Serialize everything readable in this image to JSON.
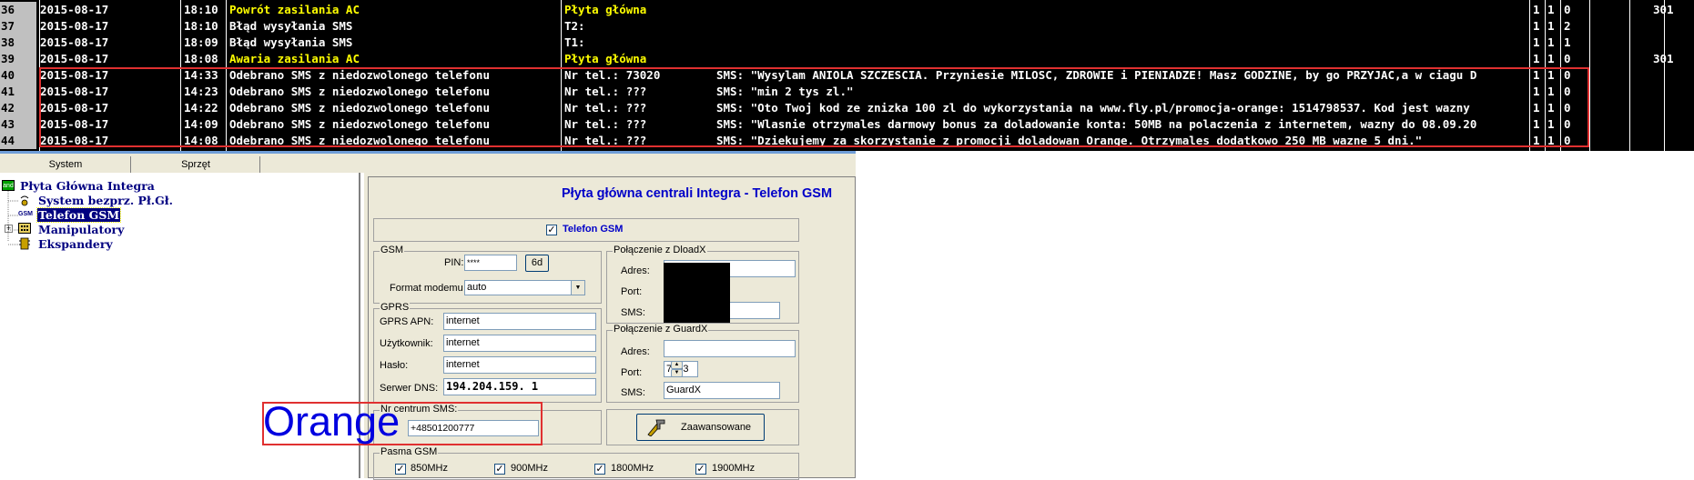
{
  "log": {
    "rows": [
      {
        "num": "36",
        "date": "2015-08-17",
        "time": "18:10",
        "desc": "Powrót zasilania AC",
        "src": "Płyta główna",
        "extra": "",
        "f1": "1",
        "f2": "1",
        "f3": "0",
        "f4": "301",
        "yellow": true
      },
      {
        "num": "37",
        "date": "2015-08-17",
        "time": "18:10",
        "desc": "Błąd wysyłania SMS",
        "src": "T2:",
        "extra": "",
        "f1": "1",
        "f2": "1",
        "f3": "2",
        "f4": "",
        "yellow": false
      },
      {
        "num": "38",
        "date": "2015-08-17",
        "time": "18:09",
        "desc": "Błąd wysyłania SMS",
        "src": "T1:",
        "extra": "",
        "f1": "1",
        "f2": "1",
        "f3": "1",
        "f4": "",
        "yellow": false
      },
      {
        "num": "39",
        "date": "2015-08-17",
        "time": "18:08",
        "desc": "Awaria zasilania AC",
        "src": "Płyta główna",
        "extra": "",
        "f1": "1",
        "f2": "1",
        "f3": "0",
        "f4": "301",
        "yellow": true
      },
      {
        "num": "40",
        "date": "2015-08-17",
        "time": "14:33",
        "desc": "Odebrano SMS z niedozwolonego telefonu",
        "src": "Nr tel.: 73020",
        "extra": "SMS: \"Wysylam ANIOLA SZCZESCIA. Przyniesie MILOSC, ZDROWIE i PIENIADZE! Masz GODZINE, by go PRZYJAC,a w ciagu D",
        "f1": "1",
        "f2": "1",
        "f3": "0",
        "f4": "",
        "yellow": false
      },
      {
        "num": "41",
        "date": "2015-08-17",
        "time": "14:23",
        "desc": "Odebrano SMS z niedozwolonego telefonu",
        "src": "Nr tel.: ???",
        "extra": "SMS: \"min 2 tys zl.\"",
        "f1": "1",
        "f2": "1",
        "f3": "0",
        "f4": "",
        "yellow": false
      },
      {
        "num": "42",
        "date": "2015-08-17",
        "time": "14:22",
        "desc": "Odebrano SMS z niedozwolonego telefonu",
        "src": "Nr tel.: ???",
        "extra": "SMS: \"Oto Twoj kod ze znizka 100 zl do wykorzystania na www.fly.pl/promocja-orange: 1514798537. Kod jest wazny",
        "f1": "1",
        "f2": "1",
        "f3": "0",
        "f4": "",
        "yellow": false
      },
      {
        "num": "43",
        "date": "2015-08-17",
        "time": "14:09",
        "desc": "Odebrano SMS z niedozwolonego telefonu",
        "src": "Nr tel.: ???",
        "extra": "SMS: \"Wlasnie otrzymales darmowy bonus za doladowanie konta: 50MB na polaczenia z internetem, wazny do 08.09.20",
        "f1": "1",
        "f2": "1",
        "f3": "0",
        "f4": "",
        "yellow": false
      },
      {
        "num": "44",
        "date": "2015-08-17",
        "time": "14:08",
        "desc": "Odebrano SMS z niedozwolonego telefonu",
        "src": "Nr tel.: ???",
        "extra": "SMS: \"Dziekujemy za skorzystanie z promocji doladowan Orange. Otrzymales dodatkowo 250 MB wazne 5 dni.\"",
        "f1": "1",
        "f2": "1",
        "f3": "0",
        "f4": "",
        "yellow": false
      }
    ]
  },
  "tabs": [
    "System",
    "Sprzęt"
  ],
  "tree": {
    "root": "Płyta Główna Integra",
    "items": [
      {
        "label": "System bezprz. Pł.Gł.",
        "icon": "wireless-icon"
      },
      {
        "label": "Telefon GSM",
        "icon": "gsm-icon",
        "selected": true
      },
      {
        "label": "Manipulatory",
        "icon": "keypad-icon"
      },
      {
        "label": "Ekspandery",
        "icon": "expander-icon"
      }
    ],
    "icon_text": {
      "root": "and",
      "gsm": "GSM"
    }
  },
  "panel": {
    "title": "Płyta główna centrali Integra  - Telefon GSM",
    "gsm_checkbox_label": "Telefon GSM",
    "gsm_group": {
      "title": "GSM",
      "pin_label": "PIN:",
      "pin_value": "****",
      "pin_button": "6d",
      "format_label": "Format modemu :",
      "format_value": "auto"
    },
    "gprs_group": {
      "title": "GPRS",
      "apn_label": "GPRS APN:",
      "apn_value": "internet",
      "user_label": "Użytkownik:",
      "user_value": "internet",
      "pass_label": "Hasło:",
      "pass_value": "internet",
      "dns_label": "Serwer DNS:",
      "dns_value": "194.204.159.  1"
    },
    "sms_center": {
      "title": "Nr centrum SMS:",
      "value": "+48501200777"
    },
    "dloadx": {
      "title": "Połączenie z DloadX",
      "addr_label": "Adres:",
      "port_label": "Port:",
      "sms_label": "SMS:"
    },
    "guardx": {
      "title": "Połączenie z GuardX",
      "addr_label": "Adres:",
      "port_label": "Port:",
      "port_value": "7093",
      "sms_label": "SMS:",
      "sms_value": "GuardX"
    },
    "advanced_button": "Zaawansowane",
    "bands": {
      "title": "Pasma GSM",
      "items": [
        "850MHz",
        "900MHz",
        "1800MHz",
        "1900MHz"
      ]
    }
  },
  "annotation": {
    "text": "Orange"
  },
  "colors": {
    "accent_red": "#e03030",
    "title_blue": "#0000c8",
    "log_yellow": "#ffff00"
  }
}
